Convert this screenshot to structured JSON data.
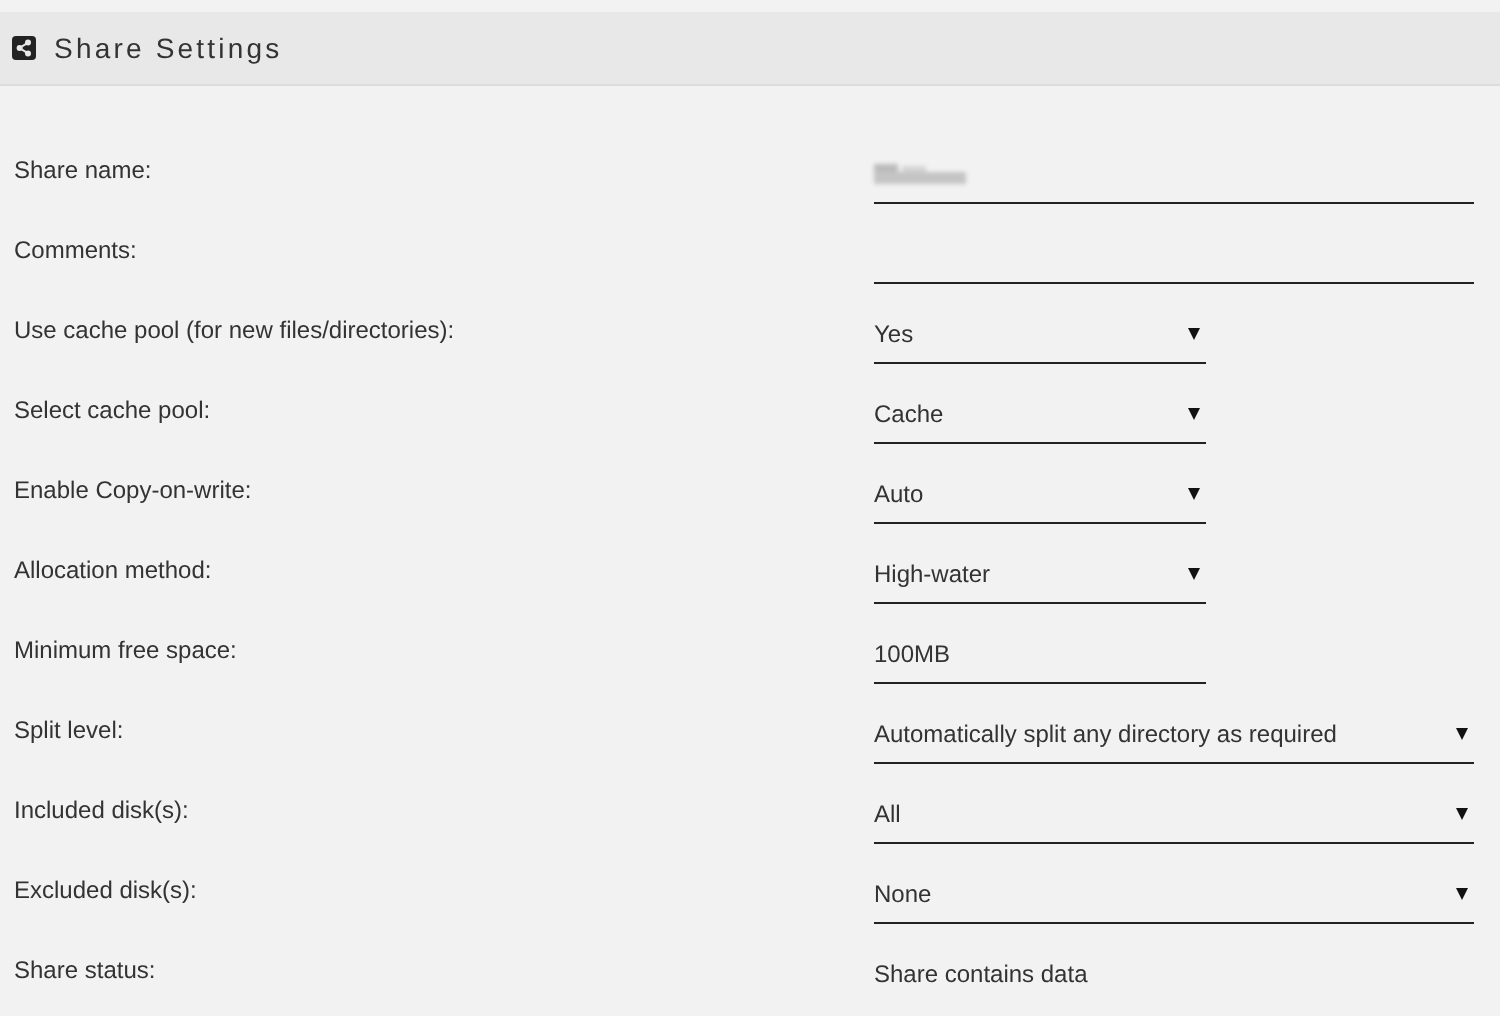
{
  "header": {
    "title": "Share Settings"
  },
  "rows": [
    {
      "label": "Share name:",
      "kind": "textbox",
      "redacted": true
    },
    {
      "label": "Comments:",
      "kind": "textbox",
      "redacted": false
    },
    {
      "label": "Use cache pool (for new files/directories):",
      "kind": "select",
      "value": "Yes"
    },
    {
      "label": "Select cache pool:",
      "kind": "select",
      "value": "Cache"
    },
    {
      "label": "Enable Copy-on-write:",
      "kind": "select",
      "value": "Auto"
    },
    {
      "label": "Allocation method:",
      "kind": "select",
      "value": "High-water"
    },
    {
      "label": "Minimum free space:",
      "kind": "number",
      "value": "100MB"
    },
    {
      "label": "Split level:",
      "kind": "combo",
      "value": "Automatically split any directory as required"
    },
    {
      "label": "Included disk(s):",
      "kind": "combo",
      "value": "All"
    },
    {
      "label": "Excluded disk(s):",
      "kind": "combo",
      "value": "None"
    },
    {
      "label": "Share status:",
      "kind": "status",
      "value": "Share contains data"
    }
  ]
}
